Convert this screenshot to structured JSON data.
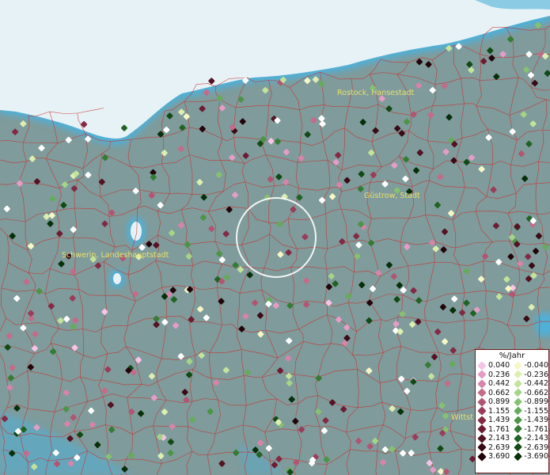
{
  "map": {
    "labels": [
      {
        "name": "rostock-label",
        "text": "Rostock, Hansestadt"
      },
      {
        "name": "guestrow-label",
        "text": "Güstrow, Stadt"
      },
      {
        "name": "schwerin-label",
        "text": "Schwerin, Landeshauptstadt"
      },
      {
        "name": "wittstock-label",
        "text": "Wittst"
      }
    ],
    "colors": {
      "land": "#7f9b9b",
      "sea": "#e6f2f6",
      "coast": "#4fb0d8",
      "border": "#cc2a2a",
      "selection_ring": "#ffffff"
    }
  },
  "legend": {
    "title": "%/Jahr",
    "positive": [
      {
        "value": "0.040",
        "color": "#f7c3e6"
      },
      {
        "value": "0.236",
        "color": "#e59cc6"
      },
      {
        "value": "0.442",
        "color": "#d684a9"
      },
      {
        "value": "0.662",
        "color": "#c46b8a"
      },
      {
        "value": "0.899",
        "color": "#b25573"
      },
      {
        "value": "1.155",
        "color": "#9a3d5a"
      },
      {
        "value": "1.439",
        "color": "#832a45"
      },
      {
        "value": "1.761",
        "color": "#6c1c33"
      },
      {
        "value": "2.143",
        "color": "#541223"
      },
      {
        "value": "2.639",
        "color": "#3a0a15"
      },
      {
        "value": "3.690",
        "color": "#22050b"
      }
    ],
    "negative": [
      {
        "value": "-0.040",
        "color": "#f5f7c6"
      },
      {
        "value": "-0.236",
        "color": "#dcefb0"
      },
      {
        "value": "-0.442",
        "color": "#c3e39b"
      },
      {
        "value": "-0.662",
        "color": "#a5d487"
      },
      {
        "value": "-0.899",
        "color": "#86c172"
      },
      {
        "value": "-1.155",
        "color": "#66ab5c"
      },
      {
        "value": "-1.439",
        "color": "#4c9446"
      },
      {
        "value": "-1.761",
        "color": "#347c33"
      },
      {
        "value": "-2.143",
        "color": "#206323"
      },
      {
        "value": "-2.639",
        "color": "#114a15"
      },
      {
        "value": "-3.690",
        "color": "#06300a"
      }
    ]
  }
}
